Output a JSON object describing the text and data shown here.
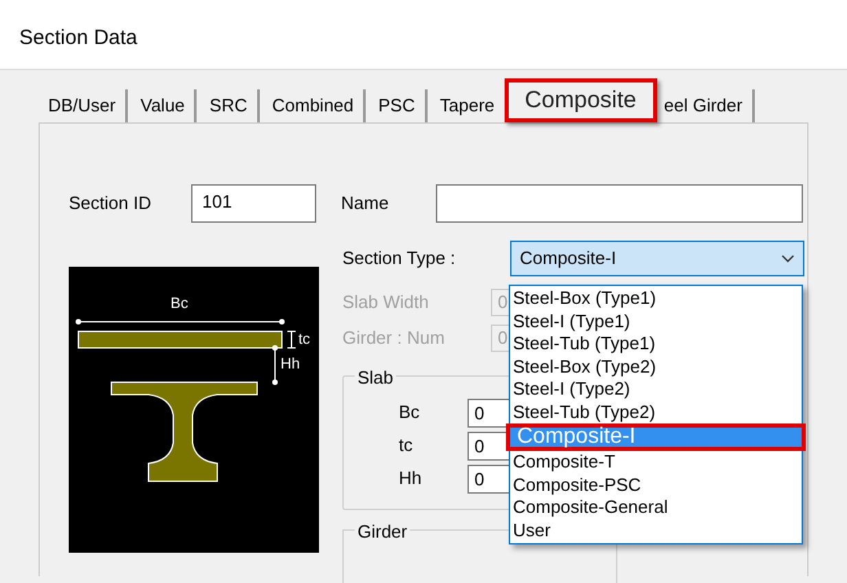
{
  "window": {
    "title": "Section Data"
  },
  "tabs": [
    {
      "label": "DB/User",
      "selected": false
    },
    {
      "label": "Value",
      "selected": false
    },
    {
      "label": "SRC",
      "selected": false
    },
    {
      "label": "Combined",
      "selected": false
    },
    {
      "label": "PSC",
      "selected": false
    },
    {
      "label": "Tapere",
      "selected": false
    },
    {
      "label": "Composite",
      "selected": true
    },
    {
      "label": "eel Girder",
      "selected": false
    }
  ],
  "section_id": {
    "label": "Section ID",
    "value": "101"
  },
  "name": {
    "label": "Name"
  },
  "section_type": {
    "label": "Section Type :",
    "value": "Composite-I",
    "expanded": true,
    "options": [
      {
        "label": "Steel-Box (Type1)",
        "selected": false
      },
      {
        "label": "Steel-I (Type1)",
        "selected": false
      },
      {
        "label": "Steel-Tub (Type1)",
        "selected": false
      },
      {
        "label": "Steel-Box (Type2)",
        "selected": false
      },
      {
        "label": "Steel-I (Type2)",
        "selected": false
      },
      {
        "label": "Steel-Tub (Type2)",
        "selected": false
      },
      {
        "label": "Composite-I",
        "selected": true
      },
      {
        "label": "Composite-T",
        "selected": false
      },
      {
        "label": "Composite-PSC",
        "selected": false
      },
      {
        "label": "Composite-General",
        "selected": false
      },
      {
        "label": "User",
        "selected": false
      }
    ]
  },
  "slab_width": {
    "label": "Slab Width",
    "value": "0",
    "disabled": true
  },
  "girder_num": {
    "label": "Girder : Num",
    "value": "0",
    "disabled": true
  },
  "diagram": {
    "labels": [
      "Bc",
      "tc",
      "Hh"
    ]
  },
  "slab": {
    "title": "Slab",
    "fields": [
      {
        "label": "Bc",
        "value": "0"
      },
      {
        "label": "tc",
        "value": "0"
      },
      {
        "label": "Hh",
        "value": "0"
      }
    ]
  },
  "girder": {
    "title": "Girder"
  }
}
